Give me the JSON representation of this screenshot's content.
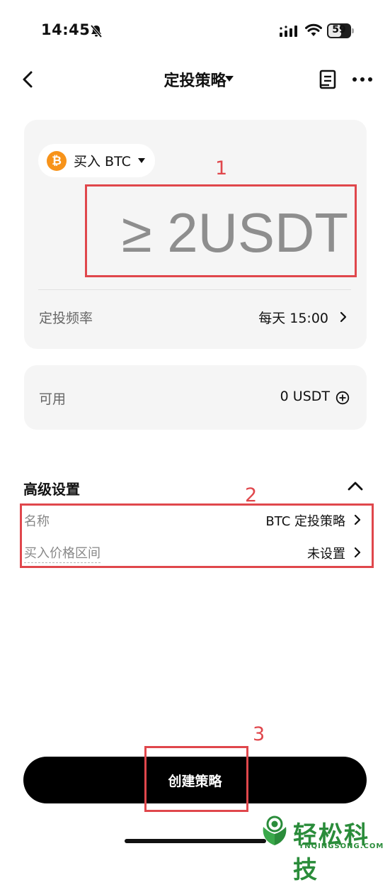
{
  "status_bar": {
    "time": "14:45",
    "battery": "59"
  },
  "nav": {
    "title": "定投策略"
  },
  "buy_card": {
    "asset_label": "买入 BTC",
    "coin_symbol": "₿",
    "amount_placeholder": "≥ 2USDT",
    "frequency_label": "定投频率",
    "frequency_value": "每天 15:00"
  },
  "available": {
    "label": "可用",
    "value": "0 USDT"
  },
  "advanced": {
    "title": "高级设置",
    "name_label": "名称",
    "name_value": "BTC 定投策略",
    "price_range_label": "买入价格区间",
    "price_range_value": "未设置"
  },
  "annotations": {
    "one": "1",
    "two": "2",
    "three": "3"
  },
  "create_button": {
    "label": "创建策略"
  },
  "watermark": {
    "text": "轻松科技",
    "subtext": "YNQINGSONG.COM"
  },
  "colors": {
    "annotation": "#e0474c",
    "btc": "#f7931a",
    "button": "#000000",
    "watermark": "#2a8c3a"
  }
}
